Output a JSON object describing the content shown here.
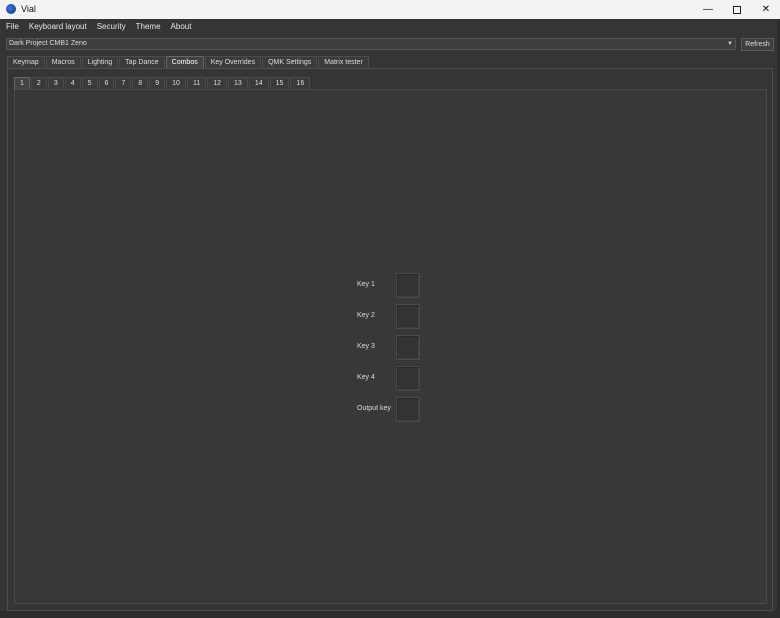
{
  "window": {
    "title": "Vial",
    "minimize": "—",
    "close": "✕"
  },
  "menu": [
    "File",
    "Keyboard layout",
    "Security",
    "Theme",
    "About"
  ],
  "device": {
    "selected": "Dark Project CMB1 Zeno",
    "refresh_label": "Refresh"
  },
  "main_tabs": {
    "items": [
      "Keymap",
      "Macros",
      "Lighting",
      "Tap Dance",
      "Combos",
      "Key Overrides",
      "QMK Settings",
      "Matrix tester"
    ],
    "active": "Combos"
  },
  "combo_tabs": {
    "items": [
      "1",
      "2",
      "3",
      "4",
      "5",
      "6",
      "7",
      "8",
      "9",
      "10",
      "11",
      "12",
      "13",
      "14",
      "15",
      "16"
    ],
    "active": "1"
  },
  "combo_keys": [
    "Key 1",
    "Key 2",
    "Key 3",
    "Key 4",
    "Output key"
  ],
  "colors": {
    "background": "#353535",
    "titlebar": "#f3f3f3",
    "text": "#e8e8e8"
  }
}
